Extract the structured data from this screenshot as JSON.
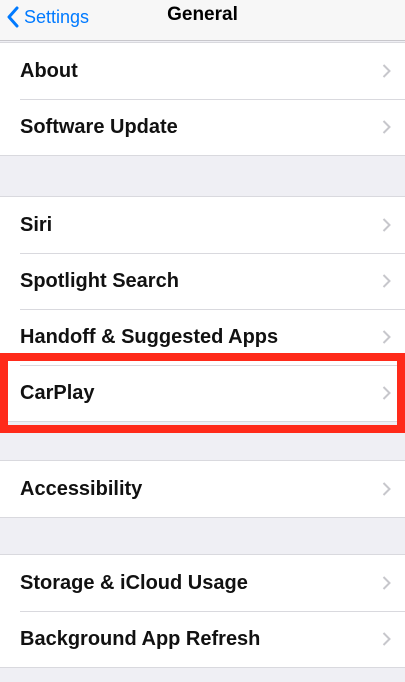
{
  "nav": {
    "back_label": "Settings",
    "title": "General"
  },
  "groups": [
    {
      "items": [
        {
          "label": "About"
        },
        {
          "label": "Software Update"
        }
      ]
    },
    {
      "items": [
        {
          "label": "Siri"
        },
        {
          "label": "Spotlight Search"
        },
        {
          "label": "Handoff & Suggested Apps"
        },
        {
          "label": "CarPlay"
        }
      ]
    },
    {
      "items": [
        {
          "label": "Accessibility"
        }
      ]
    },
    {
      "items": [
        {
          "label": "Storage & iCloud Usage"
        },
        {
          "label": "Background App Refresh"
        }
      ]
    }
  ],
  "colors": {
    "accent": "#007aff",
    "highlight": "#ff2a1a",
    "background": "#efeff4"
  },
  "icons": {
    "back": "chevron-left-icon",
    "disclosure": "chevron-right-icon"
  }
}
